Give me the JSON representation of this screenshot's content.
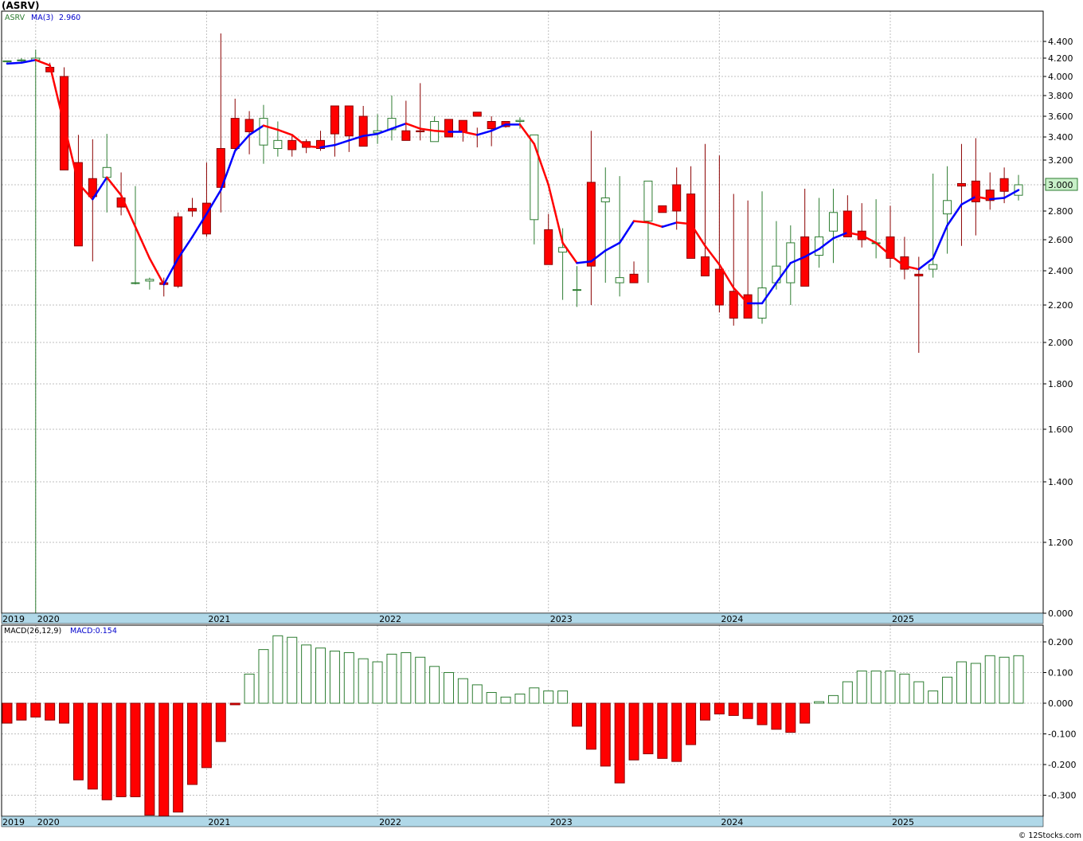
{
  "title": "(ASRV)",
  "watermark": "© 12Stocks.com",
  "colors": {
    "up": "#2e7d32",
    "down": "#ff0000",
    "ma": "#0000ff",
    "axisband": "#b0d8e8",
    "grid": "#bfbfbf",
    "lastbox": "#c8f0c8"
  },
  "legend": {
    "symbol": "ASRV",
    "ma_label": "MA(3)",
    "ma_value": "2.960"
  },
  "macd_legend": {
    "label": "MACD(26,12,9)",
    "value": "MACD:0.154"
  },
  "last_price_label": "3.000",
  "price_axis": {
    "ticks": [
      "4.400",
      "4.200",
      "4.000",
      "3.800",
      "3.600",
      "3.400",
      "3.200",
      "3.000",
      "2.800",
      "2.600",
      "2.400",
      "2.200",
      "2.000",
      "1.800",
      "1.600",
      "1.400",
      "1.200",
      "0.000"
    ]
  },
  "macd_axis": {
    "ticks": [
      "0.200",
      "0.100",
      "0.000",
      "-0.100",
      "-0.200",
      "-0.300"
    ]
  },
  "year_labels": [
    "2019",
    "2020",
    "2021",
    "2022",
    "2023",
    "2024",
    "2025"
  ],
  "chart_data": [
    {
      "type": "candlestick",
      "scale": "log",
      "ylim": [
        0,
        4.6
      ],
      "x": [
        "2019-11",
        "2019-12",
        "2020-01",
        "2020-02",
        "2020-03",
        "2020-04",
        "2020-05",
        "2020-06",
        "2020-07",
        "2020-08",
        "2020-09",
        "2020-10",
        "2020-11",
        "2020-12",
        "2021-01",
        "2021-02",
        "2021-03",
        "2021-04",
        "2021-05",
        "2021-06",
        "2021-07",
        "2021-08",
        "2021-09",
        "2021-10",
        "2021-11",
        "2021-12",
        "2022-01",
        "2022-02",
        "2022-03",
        "2022-04",
        "2022-05",
        "2022-06",
        "2022-07",
        "2022-08",
        "2022-09",
        "2022-10",
        "2022-11",
        "2022-12",
        "2023-01",
        "2023-02",
        "2023-03",
        "2023-04",
        "2023-05",
        "2023-06",
        "2023-07",
        "2023-08",
        "2023-09",
        "2023-10",
        "2023-11",
        "2023-12",
        "2024-01",
        "2024-02",
        "2024-03",
        "2024-04",
        "2024-05",
        "2024-06",
        "2024-07",
        "2024-08",
        "2024-09",
        "2024-10",
        "2024-11",
        "2024-12",
        "2025-01",
        "2025-02",
        "2025-03",
        "2025-04",
        "2025-05",
        "2025-06",
        "2025-07",
        "2025-08",
        "2025-09",
        "2025-10"
      ],
      "open": [
        4.16,
        4.18,
        4.18,
        4.1,
        4.0,
        3.18,
        3.05,
        3.06,
        2.9,
        2.33,
        2.34,
        2.33,
        2.76,
        2.82,
        2.86,
        3.3,
        3.58,
        3.57,
        3.33,
        3.3,
        3.37,
        3.36,
        3.37,
        3.7,
        3.7,
        3.6,
        3.44,
        3.47,
        3.46,
        3.46,
        3.36,
        3.57,
        3.56,
        3.64,
        3.55,
        3.55,
        3.55,
        2.74,
        2.67,
        2.52,
        2.29,
        3.02,
        2.87,
        2.33,
        2.38,
        2.73,
        2.84,
        3.0,
        2.93,
        2.49,
        2.41,
        2.28,
        2.26,
        2.13,
        2.33,
        2.33,
        2.62,
        2.5,
        2.66,
        2.8,
        2.66,
        2.58,
        2.62,
        2.49,
        2.38,
        2.41,
        2.78,
        3.01,
        3.03,
        2.96,
        3.05,
        2.92
      ],
      "high": [
        4.17,
        4.2,
        4.3,
        4.15,
        4.1,
        3.42,
        3.38,
        3.43,
        3.1,
        2.99,
        2.36,
        2.36,
        2.79,
        2.9,
        3.18,
        4.5,
        3.77,
        3.65,
        3.71,
        3.55,
        3.41,
        3.38,
        3.46,
        3.47,
        3.43,
        3.7,
        3.62,
        3.8,
        3.75,
        3.93,
        3.6,
        3.5,
        3.44,
        3.49,
        3.6,
        3.54,
        3.59,
        2.78,
        2.78,
        2.68,
        2.43,
        3.46,
        3.14,
        3.07,
        2.46,
        2.77,
        2.7,
        3.14,
        3.15,
        3.34,
        3.24,
        2.93,
        2.88,
        2.95,
        2.73,
        2.7,
        2.97,
        2.9,
        2.97,
        2.92,
        2.86,
        2.89,
        2.84,
        2.62,
        2.49,
        3.09,
        3.15,
        3.34,
        3.39,
        3.1,
        3.14,
        3.08
      ],
      "low": [
        4.14,
        4.15,
        0.0,
        4.05,
        3.73,
        2.61,
        2.46,
        2.79,
        2.77,
        2.32,
        2.29,
        2.25,
        2.3,
        2.76,
        2.62,
        2.79,
        3.29,
        3.25,
        3.17,
        3.23,
        3.23,
        3.26,
        3.28,
        3.23,
        3.27,
        3.37,
        3.34,
        3.37,
        3.38,
        3.37,
        3.36,
        3.42,
        3.36,
        3.31,
        3.32,
        3.49,
        3.48,
        2.57,
        2.57,
        2.23,
        2.19,
        2.2,
        2.33,
        2.25,
        2.33,
        2.33,
        2.69,
        2.67,
        2.63,
        2.39,
        2.16,
        2.09,
        2.17,
        2.1,
        2.29,
        2.2,
        2.41,
        2.42,
        2.45,
        2.63,
        2.55,
        2.48,
        2.42,
        2.35,
        1.95,
        2.36,
        2.51,
        2.56,
        2.63,
        2.81,
        2.86,
        2.88
      ],
      "close": [
        4.17,
        4.18,
        4.2,
        4.05,
        3.12,
        2.56,
        2.91,
        3.14,
        2.83,
        2.33,
        2.35,
        2.32,
        2.31,
        2.8,
        2.64,
        2.98,
        3.3,
        3.45,
        3.58,
        3.37,
        3.29,
        3.31,
        3.3,
        3.43,
        3.41,
        3.32,
        3.46,
        3.58,
        3.37,
        3.45,
        3.55,
        3.4,
        3.45,
        3.6,
        3.48,
        3.5,
        3.56,
        3.42,
        2.44,
        2.55,
        2.29,
        2.43,
        2.9,
        2.36,
        2.33,
        3.03,
        2.79,
        2.8,
        2.48,
        2.37,
        2.2,
        2.13,
        2.13,
        2.3,
        2.43,
        2.58,
        2.31,
        2.62,
        2.79,
        2.62,
        2.6,
        2.58,
        2.48,
        2.41,
        2.37,
        2.44,
        2.88,
        2.99,
        2.87,
        2.88,
        2.95,
        3.0
      ],
      "ma3": [
        4.14,
        4.15,
        4.18,
        4.12,
        3.52,
        3.01,
        2.89,
        3.06,
        2.92,
        2.69,
        2.48,
        2.32,
        2.48,
        2.62,
        2.78,
        2.96,
        3.28,
        3.42,
        3.51,
        3.47,
        3.42,
        3.32,
        3.31,
        3.33,
        3.37,
        3.41,
        3.43,
        3.48,
        3.53,
        3.48,
        3.46,
        3.45,
        3.45,
        3.42,
        3.46,
        3.52,
        3.52,
        3.34,
        3.0,
        2.58,
        2.45,
        2.46,
        2.53,
        2.58,
        2.73,
        2.72,
        2.69,
        2.72,
        2.71,
        2.56,
        2.44,
        2.3,
        2.21,
        2.21,
        2.33,
        2.45,
        2.49,
        2.54,
        2.61,
        2.65,
        2.63,
        2.58,
        2.5,
        2.43,
        2.41,
        2.48,
        2.7,
        2.85,
        2.91,
        2.89,
        2.9,
        2.96
      ]
    },
    {
      "type": "bar",
      "title": "MACD(26,12,9)",
      "ylim": [
        -0.36,
        0.24
      ],
      "x": [
        "2019-11",
        "2019-12",
        "2020-01",
        "2020-02",
        "2020-03",
        "2020-04",
        "2020-05",
        "2020-06",
        "2020-07",
        "2020-08",
        "2020-09",
        "2020-10",
        "2020-11",
        "2020-12",
        "2021-01",
        "2021-02",
        "2021-03",
        "2021-04",
        "2021-05",
        "2021-06",
        "2021-07",
        "2021-08",
        "2021-09",
        "2021-10",
        "2021-11",
        "2021-12",
        "2022-01",
        "2022-02",
        "2022-03",
        "2022-04",
        "2022-05",
        "2022-06",
        "2022-07",
        "2022-08",
        "2022-09",
        "2022-10",
        "2022-11",
        "2022-12",
        "2023-01",
        "2023-02",
        "2023-03",
        "2023-04",
        "2023-05",
        "2023-06",
        "2023-07",
        "2023-08",
        "2023-09",
        "2023-10",
        "2023-11",
        "2023-12",
        "2024-01",
        "2024-02",
        "2024-03",
        "2024-04",
        "2024-05",
        "2024-06",
        "2024-07",
        "2024-08",
        "2024-09",
        "2024-10",
        "2024-11",
        "2024-12",
        "2025-01",
        "2025-02",
        "2025-03",
        "2025-04",
        "2025-05",
        "2025-06",
        "2025-07",
        "2025-08",
        "2025-09",
        "2025-10"
      ],
      "values": [
        -0.065,
        -0.055,
        -0.045,
        -0.055,
        -0.065,
        -0.25,
        -0.28,
        -0.315,
        -0.305,
        -0.305,
        -0.365,
        -0.375,
        -0.355,
        -0.265,
        -0.21,
        -0.125,
        -0.005,
        0.095,
        0.175,
        0.22,
        0.215,
        0.19,
        0.18,
        0.17,
        0.165,
        0.145,
        0.135,
        0.16,
        0.165,
        0.15,
        0.12,
        0.1,
        0.08,
        0.06,
        0.035,
        0.02,
        0.03,
        0.05,
        0.04,
        0.04,
        -0.075,
        -0.15,
        -0.205,
        -0.26,
        -0.185,
        -0.165,
        -0.18,
        -0.19,
        -0.135,
        -0.055,
        -0.035,
        -0.04,
        -0.05,
        -0.07,
        -0.085,
        -0.095,
        -0.065,
        0.005,
        0.025,
        0.07,
        0.105,
        0.105,
        0.105,
        0.095,
        0.07,
        0.04,
        0.085,
        0.135,
        0.13,
        0.155,
        0.15,
        0.155
      ]
    }
  ]
}
